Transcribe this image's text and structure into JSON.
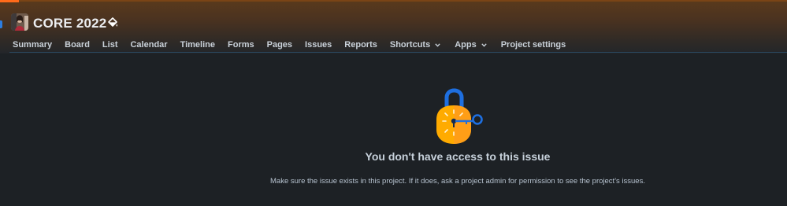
{
  "header": {
    "project_title": "CORE 2022",
    "accent_color": "#ff6a1a",
    "avatar_icon": "project-avatar",
    "theme_icon": "paint-bucket-icon"
  },
  "nav": {
    "items": [
      {
        "label": "Summary"
      },
      {
        "label": "Board"
      },
      {
        "label": "List"
      },
      {
        "label": "Calendar"
      },
      {
        "label": "Timeline"
      },
      {
        "label": "Forms"
      },
      {
        "label": "Pages"
      },
      {
        "label": "Issues"
      },
      {
        "label": "Reports"
      },
      {
        "label": "Shortcuts",
        "dropdown": true
      },
      {
        "label": "Apps",
        "dropdown": true
      },
      {
        "label": "Project settings"
      }
    ]
  },
  "main": {
    "illustration_icon": "padlock-with-key-icon",
    "title": "You don't have access to this issue",
    "description": "Make sure the issue exists in this project. If it does, ask a project admin for permission to see the project's issues."
  }
}
